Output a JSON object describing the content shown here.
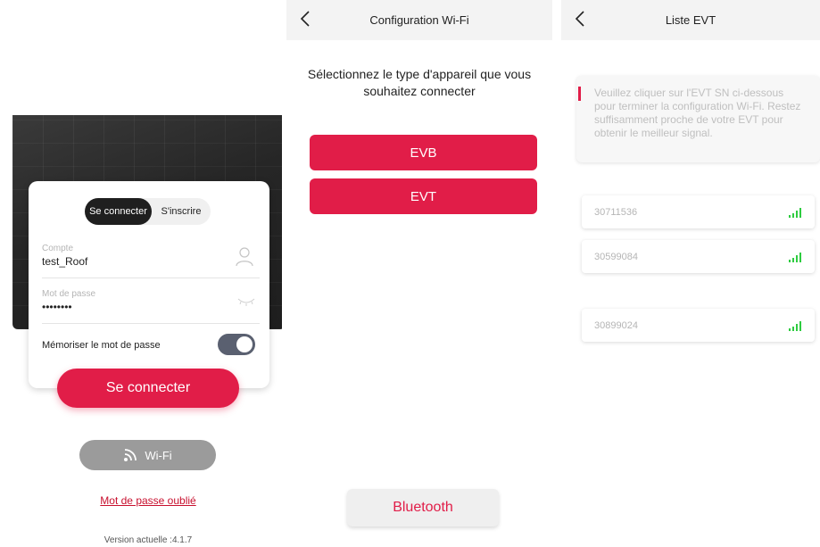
{
  "login": {
    "tabs": {
      "active": "Se connecter",
      "other": "S'inscrire"
    },
    "account": {
      "label": "Compte",
      "value": "test_Roof"
    },
    "password": {
      "label": "Mot de passe",
      "value": "••••••••"
    },
    "remember_label": "Mémoriser le mot de passe",
    "remember_on": true,
    "login_button": "Se connecter",
    "wifi_button": "Wi-Fi",
    "forgot_link": "Mot de passe oublié",
    "version": "Version actuelle :4.1.7"
  },
  "wifi_config": {
    "title": "Configuration Wi-Fi",
    "prompt": "Sélectionnez le type d'appareil que vous souhaitez connecter",
    "device_buttons": [
      "EVB",
      "EVT"
    ],
    "bluetooth_button": "Bluetooth"
  },
  "evt_list": {
    "title": "Liste EVT",
    "info": "Veuillez cliquer sur l'EVT SN ci-dessous pour terminer la configuration Wi-Fi. Restez suffisamment proche de votre EVT pour obtenir le meilleur signal.",
    "devices": [
      "30711536",
      "30599084",
      "30899024"
    ]
  },
  "colors": {
    "accent": "#e11d48",
    "signal": "#2ecc40",
    "toggle": "#5a6070"
  }
}
